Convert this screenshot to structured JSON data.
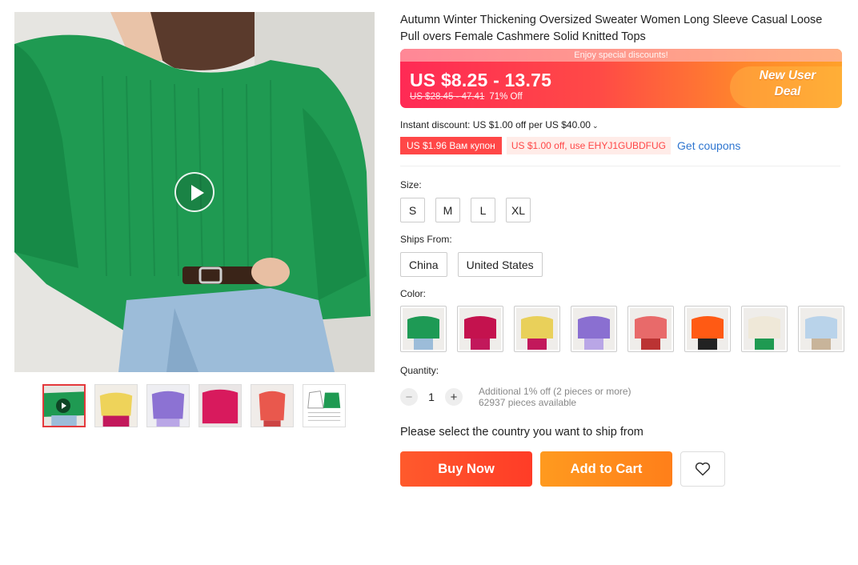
{
  "product": {
    "title": "Autumn Winter Thickening Oversized Sweater Women Long Sleeve Casual Loose Pull overs Female Cashmere Solid Knitted Tops"
  },
  "price": {
    "banner": "Enjoy special discounts!",
    "range": "US $8.25 - 13.75",
    "original": "US $28.45 - 47.41",
    "discount": "71% Off",
    "badge_line1": "New User",
    "badge_line2": "Deal"
  },
  "instant_discount": {
    "text": "Instant discount: US $1.00 off per US $40.00",
    "chevron": "⌄"
  },
  "coupons": {
    "red": "US $1.96 Вам купон",
    "light": "US $1.00 off, use EHYJ1GUBDFUG",
    "link": "Get coupons"
  },
  "size": {
    "label": "Size:",
    "options": [
      "S",
      "M",
      "L",
      "XL"
    ]
  },
  "ships_from": {
    "label": "Ships From:",
    "options": [
      "China",
      "United States"
    ]
  },
  "color": {
    "label": "Color:",
    "swatches": [
      "#1e9a55",
      "#c4124e",
      "#e9d05a",
      "#8a6fd1",
      "#e86a6a",
      "#ff5a14",
      "#efe8d8",
      "#b9d3ea"
    ]
  },
  "quantity": {
    "label": "Quantity:",
    "minus": "−",
    "value": "1",
    "plus": "+",
    "note1": "Additional 1% off (2 pieces or more)",
    "note2": "62937 pieces available"
  },
  "ship_message": "Please select the country you want to ship from",
  "actions": {
    "buy": "Buy Now",
    "cart": "Add to Cart"
  },
  "gallery": {
    "main_color": "#1f9a52",
    "thumb_colors": [
      "#1f9a52",
      "#eed35a",
      "#8c72d3",
      "#d81a5d",
      "#e9584d",
      "#ffffff"
    ]
  }
}
